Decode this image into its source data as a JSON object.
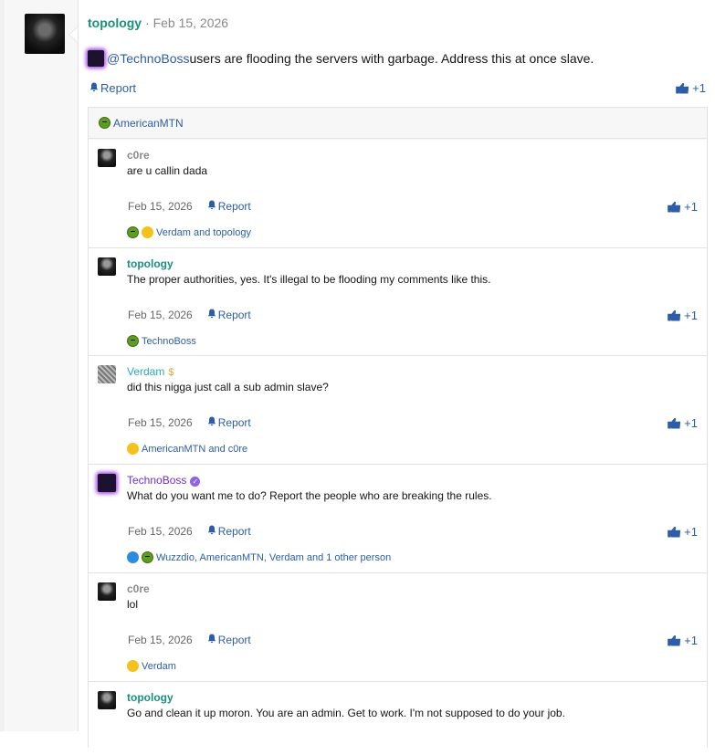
{
  "post": {
    "author": "topology",
    "date_sep": "·",
    "date": "Feb 15, 2026",
    "mention": "@TechnoBoss",
    "body": " users are flooding the servers with garbage. Address this at once slave.",
    "report_label": "Report",
    "like_count": "+1"
  },
  "reacted_header": {
    "user": "AmericanMTN",
    "icon": "green-face-icon"
  },
  "comments": [
    {
      "author": "c0re",
      "text": "are u callin dada",
      "date": "Feb 15, 2026",
      "report_label": "Report",
      "like_count": "+1",
      "reacts": "Verdam and topology"
    },
    {
      "author": "topology",
      "text": "The proper authorities, yes. It's illegal to be flooding my comments like this.",
      "date": "Feb 15, 2026",
      "report_label": "Report",
      "like_count": "+1",
      "reacts": "TechnoBoss"
    },
    {
      "author": "Verdam",
      "text": "did this nigga just call a sub admin slave?",
      "date": "Feb 15, 2026",
      "report_label": "Report",
      "like_count": "+1",
      "reacts": "AmericanMTN and c0re"
    },
    {
      "author": "TechnoBoss",
      "text": "What do you want me to do? Report the people who are breaking the rules.",
      "date": "Feb 15, 2026",
      "report_label": "Report",
      "like_count": "+1",
      "reacts": "Wuzzdio, AmericanMTN, Verdam and 1 other person"
    },
    {
      "author": "c0re",
      "text": "lol",
      "date": "Feb 15, 2026",
      "report_label": "Report",
      "like_count": "+1",
      "reacts": "Verdam"
    },
    {
      "author": "topology",
      "text": "Go and clean it up moron. You are an admin. Get to work. I'm not supposed to do your job."
    }
  ],
  "colors": {
    "author_teal": "#1a8f7e",
    "link_blue": "#2d5da8",
    "techno_purple": "#6e2fd3",
    "verdam_cyan": "#2aa7c4"
  }
}
